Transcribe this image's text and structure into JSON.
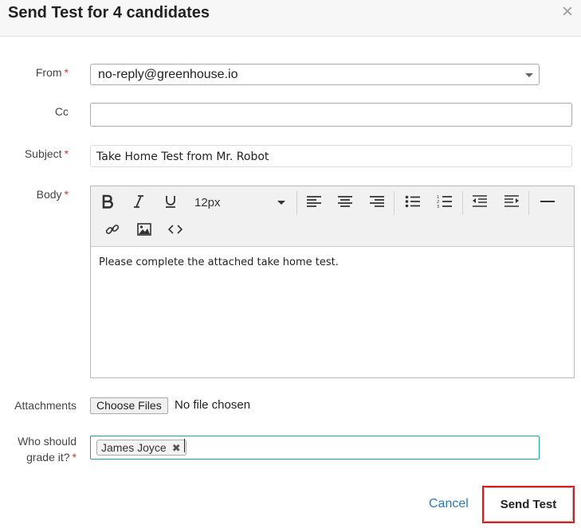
{
  "dialog": {
    "title": "Send Test for 4 candidates",
    "close_glyph": "×"
  },
  "form": {
    "from": {
      "label": "From",
      "required": "*",
      "value": "no-reply@greenhouse.io"
    },
    "cc": {
      "label": "Cc",
      "value": ""
    },
    "subject": {
      "label": "Subject",
      "required": "*",
      "value": "Take Home Test from Mr. Robot"
    },
    "body": {
      "label": "Body",
      "required": "*",
      "font_size": "12px",
      "text": "Please complete the attached take home test.",
      "toolbar_icons": [
        "bold-icon",
        "italic-icon",
        "underline-icon",
        "align-left-icon",
        "align-center-icon",
        "align-right-icon",
        "bullet-list-icon",
        "numbered-list-icon",
        "outdent-icon",
        "indent-icon",
        "horizontal-rule-icon",
        "link-icon",
        "image-icon",
        "code-icon"
      ]
    },
    "attachments": {
      "label": "Attachments",
      "button": "Choose Files",
      "status": "No file chosen"
    },
    "grader": {
      "label_line1": "Who should",
      "label_line2": "grade it?",
      "required": "*",
      "selected": "James Joyce",
      "remove_glyph": "✖"
    }
  },
  "footer": {
    "cancel": "Cancel",
    "send": "Send Test"
  },
  "colors": {
    "required": "#d0342c",
    "link": "#2a7ab8",
    "focus_border": "#1aa3a1",
    "highlight": "#e0191b"
  }
}
